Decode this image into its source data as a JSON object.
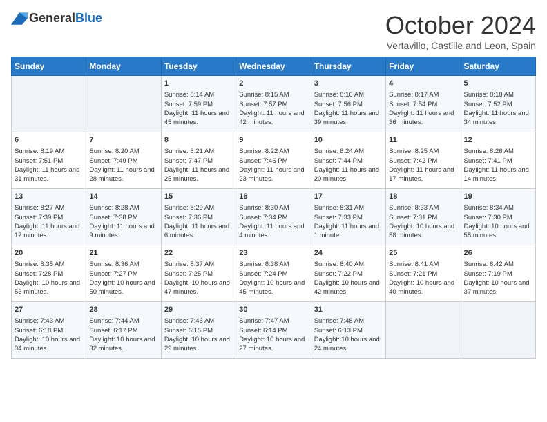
{
  "header": {
    "logo_general": "General",
    "logo_blue": "Blue",
    "month_title": "October 2024",
    "location": "Vertavillo, Castille and Leon, Spain"
  },
  "weekdays": [
    "Sunday",
    "Monday",
    "Tuesday",
    "Wednesday",
    "Thursday",
    "Friday",
    "Saturday"
  ],
  "weeks": [
    [
      {
        "day": "",
        "info": ""
      },
      {
        "day": "",
        "info": ""
      },
      {
        "day": "1",
        "info": "Sunrise: 8:14 AM\nSunset: 7:59 PM\nDaylight: 11 hours and 45 minutes."
      },
      {
        "day": "2",
        "info": "Sunrise: 8:15 AM\nSunset: 7:57 PM\nDaylight: 11 hours and 42 minutes."
      },
      {
        "day": "3",
        "info": "Sunrise: 8:16 AM\nSunset: 7:56 PM\nDaylight: 11 hours and 39 minutes."
      },
      {
        "day": "4",
        "info": "Sunrise: 8:17 AM\nSunset: 7:54 PM\nDaylight: 11 hours and 36 minutes."
      },
      {
        "day": "5",
        "info": "Sunrise: 8:18 AM\nSunset: 7:52 PM\nDaylight: 11 hours and 34 minutes."
      }
    ],
    [
      {
        "day": "6",
        "info": "Sunrise: 8:19 AM\nSunset: 7:51 PM\nDaylight: 11 hours and 31 minutes."
      },
      {
        "day": "7",
        "info": "Sunrise: 8:20 AM\nSunset: 7:49 PM\nDaylight: 11 hours and 28 minutes."
      },
      {
        "day": "8",
        "info": "Sunrise: 8:21 AM\nSunset: 7:47 PM\nDaylight: 11 hours and 25 minutes."
      },
      {
        "day": "9",
        "info": "Sunrise: 8:22 AM\nSunset: 7:46 PM\nDaylight: 11 hours and 23 minutes."
      },
      {
        "day": "10",
        "info": "Sunrise: 8:24 AM\nSunset: 7:44 PM\nDaylight: 11 hours and 20 minutes."
      },
      {
        "day": "11",
        "info": "Sunrise: 8:25 AM\nSunset: 7:42 PM\nDaylight: 11 hours and 17 minutes."
      },
      {
        "day": "12",
        "info": "Sunrise: 8:26 AM\nSunset: 7:41 PM\nDaylight: 11 hours and 14 minutes."
      }
    ],
    [
      {
        "day": "13",
        "info": "Sunrise: 8:27 AM\nSunset: 7:39 PM\nDaylight: 11 hours and 12 minutes."
      },
      {
        "day": "14",
        "info": "Sunrise: 8:28 AM\nSunset: 7:38 PM\nDaylight: 11 hours and 9 minutes."
      },
      {
        "day": "15",
        "info": "Sunrise: 8:29 AM\nSunset: 7:36 PM\nDaylight: 11 hours and 6 minutes."
      },
      {
        "day": "16",
        "info": "Sunrise: 8:30 AM\nSunset: 7:34 PM\nDaylight: 11 hours and 4 minutes."
      },
      {
        "day": "17",
        "info": "Sunrise: 8:31 AM\nSunset: 7:33 PM\nDaylight: 11 hours and 1 minute."
      },
      {
        "day": "18",
        "info": "Sunrise: 8:33 AM\nSunset: 7:31 PM\nDaylight: 10 hours and 58 minutes."
      },
      {
        "day": "19",
        "info": "Sunrise: 8:34 AM\nSunset: 7:30 PM\nDaylight: 10 hours and 55 minutes."
      }
    ],
    [
      {
        "day": "20",
        "info": "Sunrise: 8:35 AM\nSunset: 7:28 PM\nDaylight: 10 hours and 53 minutes."
      },
      {
        "day": "21",
        "info": "Sunrise: 8:36 AM\nSunset: 7:27 PM\nDaylight: 10 hours and 50 minutes."
      },
      {
        "day": "22",
        "info": "Sunrise: 8:37 AM\nSunset: 7:25 PM\nDaylight: 10 hours and 47 minutes."
      },
      {
        "day": "23",
        "info": "Sunrise: 8:38 AM\nSunset: 7:24 PM\nDaylight: 10 hours and 45 minutes."
      },
      {
        "day": "24",
        "info": "Sunrise: 8:40 AM\nSunset: 7:22 PM\nDaylight: 10 hours and 42 minutes."
      },
      {
        "day": "25",
        "info": "Sunrise: 8:41 AM\nSunset: 7:21 PM\nDaylight: 10 hours and 40 minutes."
      },
      {
        "day": "26",
        "info": "Sunrise: 8:42 AM\nSunset: 7:19 PM\nDaylight: 10 hours and 37 minutes."
      }
    ],
    [
      {
        "day": "27",
        "info": "Sunrise: 7:43 AM\nSunset: 6:18 PM\nDaylight: 10 hours and 34 minutes."
      },
      {
        "day": "28",
        "info": "Sunrise: 7:44 AM\nSunset: 6:17 PM\nDaylight: 10 hours and 32 minutes."
      },
      {
        "day": "29",
        "info": "Sunrise: 7:46 AM\nSunset: 6:15 PM\nDaylight: 10 hours and 29 minutes."
      },
      {
        "day": "30",
        "info": "Sunrise: 7:47 AM\nSunset: 6:14 PM\nDaylight: 10 hours and 27 minutes."
      },
      {
        "day": "31",
        "info": "Sunrise: 7:48 AM\nSunset: 6:13 PM\nDaylight: 10 hours and 24 minutes."
      },
      {
        "day": "",
        "info": ""
      },
      {
        "day": "",
        "info": ""
      }
    ]
  ]
}
